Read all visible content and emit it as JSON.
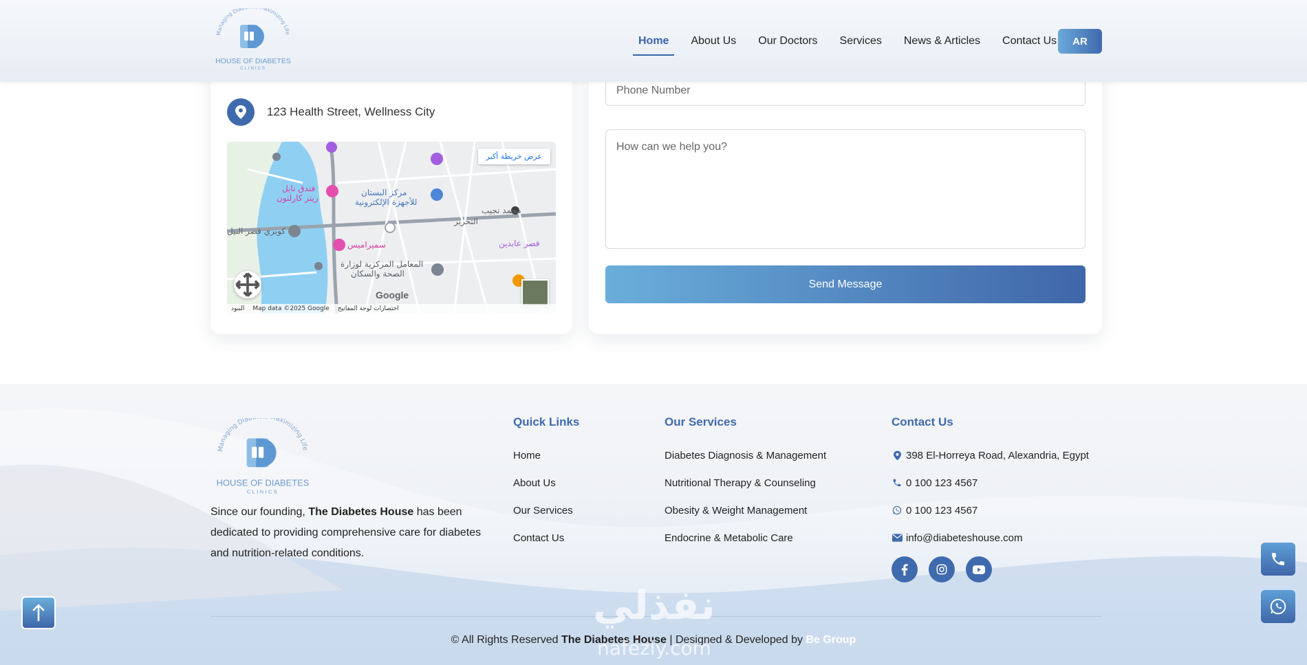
{
  "header": {
    "logo_alt": "HOUSE OF DIABETES CLINICS",
    "logo_tagline": "Managing Diabetes, Maximizing Life",
    "logo_name": "HOUSE OF DIABETES",
    "logo_sub": "CLINICS",
    "nav": [
      {
        "label": "Home",
        "active": true
      },
      {
        "label": "About Us"
      },
      {
        "label": "Our Doctors"
      },
      {
        "label": "Services"
      },
      {
        "label": "News & Articles"
      },
      {
        "label": "Contact Us"
      }
    ],
    "lang_button": "AR"
  },
  "contact": {
    "address": "123 Health Street, Wellness City",
    "map": {
      "view_larger": "عرض خريطة أكبر",
      "data_credit": "Map data ©2025 Google",
      "shortcuts": "اختصارات لوحة المفاتيح",
      "terms": "البنود",
      "google": "Google"
    },
    "form": {
      "phone_placeholder": "Phone Number",
      "message_placeholder": "How can we help you?",
      "send_button": "Send Message"
    }
  },
  "footer": {
    "about_prefix": "Since our founding,",
    "about_brand": "The Diabetes House",
    "about_suffix": "has been dedicated to providing comprehensive care for diabetes and nutrition-related conditions.",
    "quick_links": {
      "title": "Quick Links",
      "items": [
        "Home",
        "About Us",
        "Our Services",
        "Contact Us"
      ]
    },
    "services": {
      "title": "Our Services",
      "items": [
        "Diabetes Diagnosis & Management",
        "Nutritional Therapy & Counseling",
        "Obesity & Weight Management",
        "Endocrine & Metabolic Care"
      ]
    },
    "contact": {
      "title": "Contact Us",
      "address": "398 El-Horreya Road, Alexandria, Egypt",
      "phone": "0 100 123 4567",
      "whatsapp": "0 100 123 4567",
      "email": "info@diabeteshouse.com"
    },
    "copyright_prefix": "© All Rights Reserved",
    "copyright_brand": "The Diabetes House",
    "copyright_mid": "| Designed & Developed by",
    "developer": "Be Group",
    "watermark_arabic": "نفذلي",
    "watermark_url": "nafezly.com"
  },
  "colors": {
    "primary": "#3f6aad",
    "accent_light": "#6aaedb",
    "text": "#222222"
  },
  "icons": {
    "address": "location-pin-icon",
    "phone": "phone-icon",
    "whatsapp": "whatsapp-icon",
    "email": "envelope-icon",
    "socials": [
      "facebook-icon",
      "instagram-icon",
      "youtube-icon"
    ]
  }
}
